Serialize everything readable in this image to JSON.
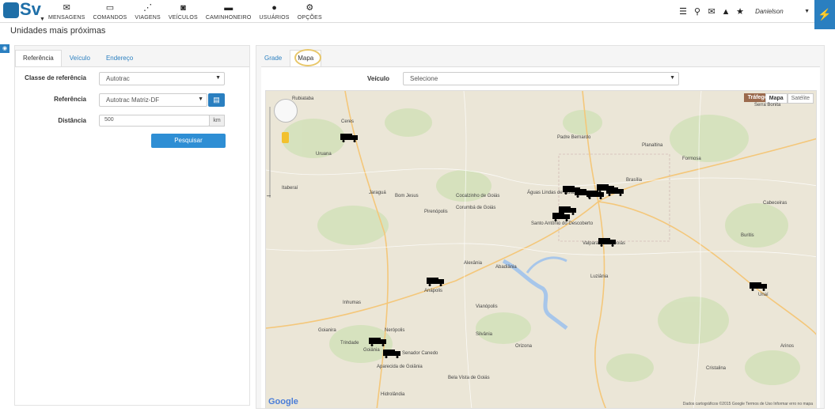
{
  "topbar": {
    "logo_text": "Sv",
    "nav": [
      {
        "icon": "envelope-icon",
        "label": "MENSAGENS"
      },
      {
        "icon": "laptop-icon",
        "label": "COMANDOS"
      },
      {
        "icon": "road-icon",
        "label": "VIAGENS"
      },
      {
        "icon": "car-icon",
        "label": "VEÍCULOS"
      },
      {
        "icon": "truck-icon",
        "label": "CAMINHONEIRO"
      },
      {
        "icon": "user-icon",
        "label": "USUÁRIOS"
      },
      {
        "icon": "gears-icon",
        "label": "OPÇÕES"
      }
    ],
    "user_name": "Danielson"
  },
  "page": {
    "title": "Unidades mais próximas"
  },
  "left_panel": {
    "tabs": [
      "Referência",
      "Veículo",
      "Endereço"
    ],
    "active_tab": "Referência",
    "form": {
      "classe_label": "Classe de referência",
      "classe_value": "Autotrac",
      "referencia_label": "Referência",
      "referencia_value": "Autotrac Matriz-DF",
      "distancia_label": "Distância",
      "distancia_value": "500",
      "distancia_unit": "km",
      "search_button": "Pesquisar"
    }
  },
  "right_panel": {
    "tabs": [
      "Grade",
      "Mapa"
    ],
    "active_tab": "Mapa",
    "veiculo_label": "Veículo",
    "veiculo_value": "Selecione",
    "map": {
      "traffic_label": "Tráfego",
      "type_options": [
        "Mapa",
        "Satélite"
      ],
      "selected_type": "Mapa",
      "google_logo": "Google",
      "footer": "Dados cartográficos ©2015 Google   Termos de Uso   Informar erro no mapa",
      "places": [
        "Rubiataba",
        "Ceres",
        "Uruana",
        "Itaberaí",
        "Jaraguá",
        "Bom Jesus",
        "Anápolis",
        "Goiânia",
        "Trindade",
        "Aparecida de Goiânia",
        "Senador Canedo",
        "Hidrolândia",
        "Pirenópolis",
        "Corumbá de Goiás",
        "Cocalzinho de Goiás",
        "Águas Lindas de Goiás",
        "Santo Antônio do Descoberto",
        "Valparaíso de Goiás",
        "Luziânia",
        "Unaí",
        "Formosa",
        "Planaltina",
        "Padre Bernardo",
        "Cristalina",
        "Cabeceiras",
        "Buritis",
        "Serra Bonita",
        "Arinos",
        "Brasília",
        "Alexânia",
        "Abadiânia",
        "Silvânia",
        "Vianópolis",
        "Orizona",
        "Bela Vista de Goiás",
        "Inhumas",
        "Nerópolis",
        "Goianira"
      ]
    }
  }
}
